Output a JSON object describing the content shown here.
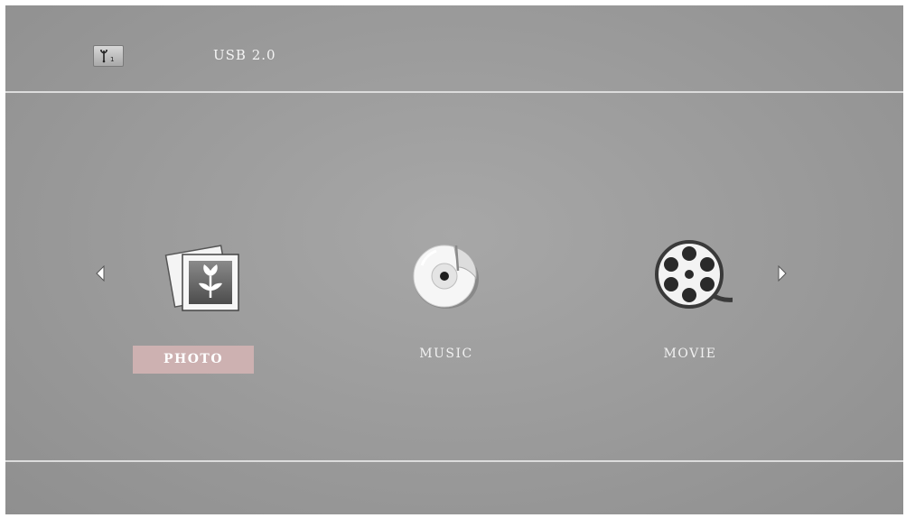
{
  "header": {
    "source_icon": "usb-icon",
    "source_label": "USB 2.0"
  },
  "menu": {
    "items": [
      {
        "label": "PHOTO",
        "icon": "photo-icon",
        "selected": true
      },
      {
        "label": "MUSIC",
        "icon": "music-disc-icon",
        "selected": false
      },
      {
        "label": "MOVIE",
        "icon": "film-reel-icon",
        "selected": false
      }
    ],
    "prev_icon": "arrow-left-icon",
    "next_icon": "arrow-right-icon"
  },
  "colors": {
    "background": "#9d9d9d",
    "divider": "#dcdcdc",
    "selection": "#cdb1b1",
    "text": "#f2f2f2"
  }
}
